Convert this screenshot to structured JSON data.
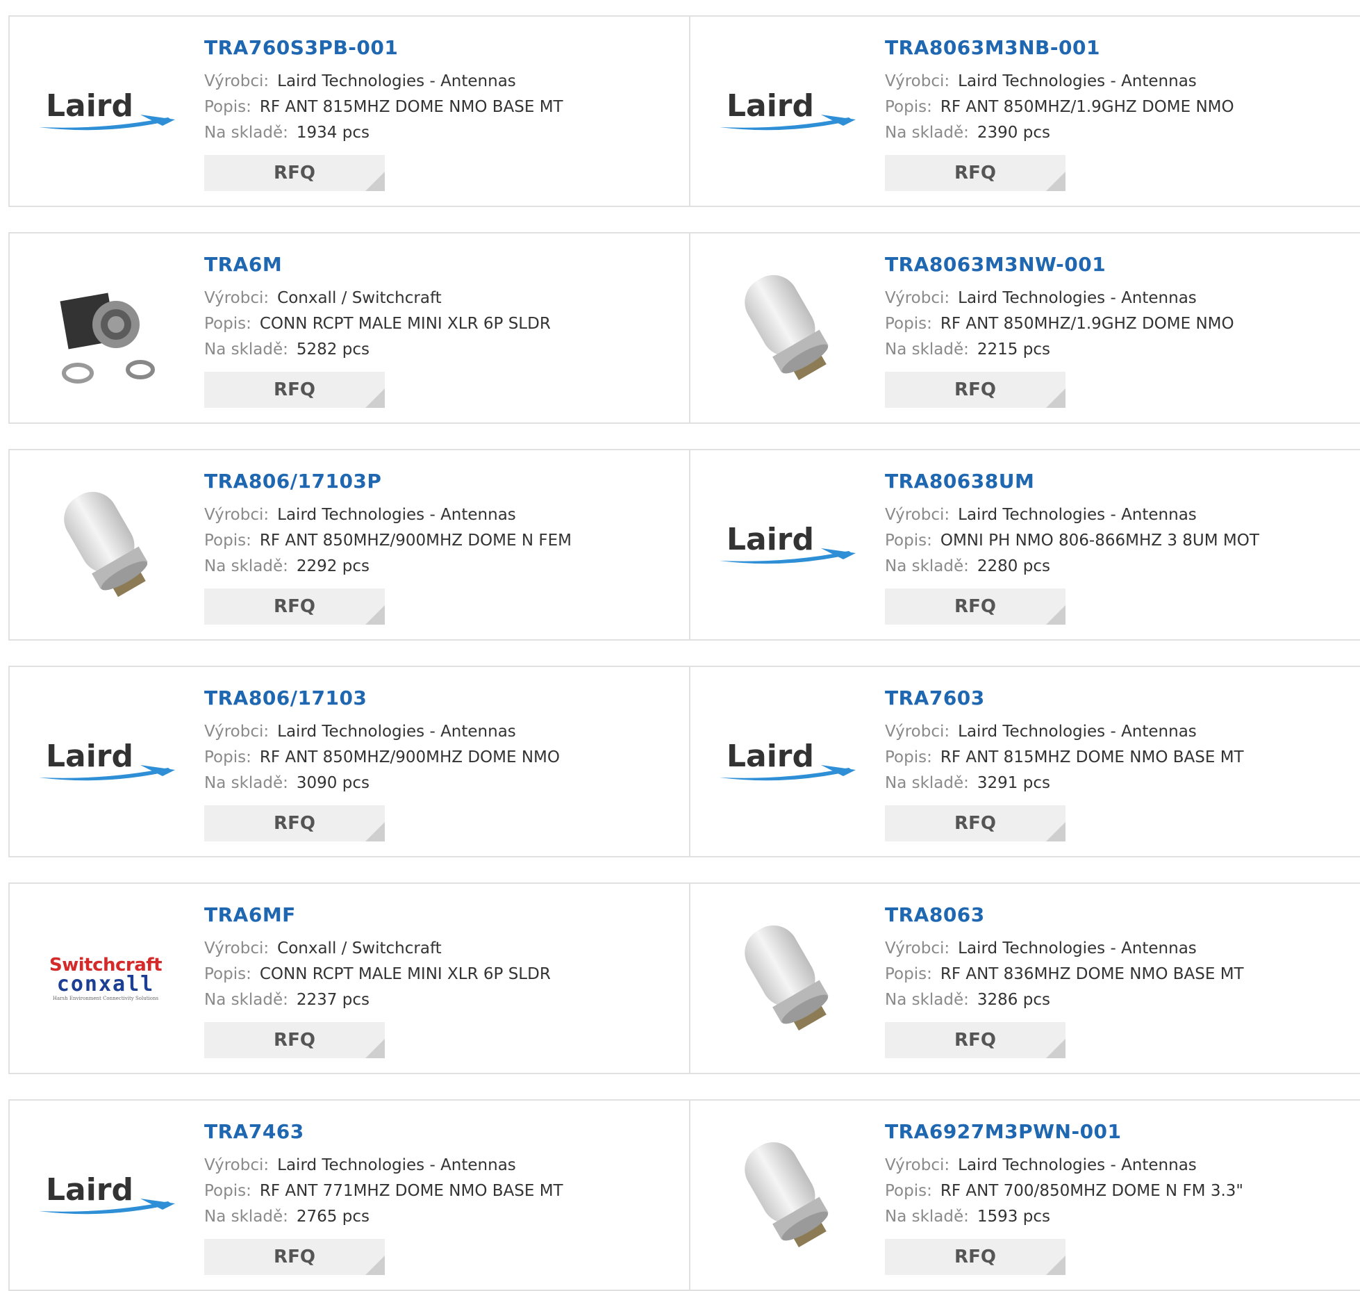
{
  "labels": {
    "manufacturer": "Výrobci:",
    "description": "Popis:",
    "stock": "Na skladě:",
    "rfq": "RFQ"
  },
  "logo_text": {
    "laird": "Laird",
    "switchcraft": "Switchcraft",
    "conxall": "conxall",
    "conxall_tagline": "Harsh Environment Connectivity Solutions"
  },
  "products": [
    {
      "part": "TRA760S3PB-001",
      "manufacturer": "Laird Technologies - Antennas",
      "description": "RF ANT 815MHZ DOME NMO BASE MT",
      "stock": "1934 pcs",
      "image": "laird-logo"
    },
    {
      "part": "TRA8063M3NB-001",
      "manufacturer": "Laird Technologies - Antennas",
      "description": "RF ANT 850MHZ/1.9GHZ DOME NMO",
      "stock": "2390 pcs",
      "image": "laird-logo"
    },
    {
      "part": "TRA6M",
      "manufacturer": "Conxall / Switchcraft",
      "description": "CONN RCPT MALE MINI XLR 6P SLDR",
      "stock": "5282 pcs",
      "image": "xlr-connector-photo"
    },
    {
      "part": "TRA8063M3NW-001",
      "manufacturer": "Laird Technologies - Antennas",
      "description": "RF ANT 850MHZ/1.9GHZ DOME NMO",
      "stock": "2215 pcs",
      "image": "antenna-photo"
    },
    {
      "part": "TRA806/17103P",
      "manufacturer": "Laird Technologies - Antennas",
      "description": "RF ANT 850MHZ/900MHZ DOME N FEM",
      "stock": "2292 pcs",
      "image": "antenna-photo"
    },
    {
      "part": "TRA80638UM",
      "manufacturer": "Laird Technologies - Antennas",
      "description": "OMNI PH NMO 806-866MHZ 3 8UM MOT",
      "stock": "2280 pcs",
      "image": "laird-logo"
    },
    {
      "part": "TRA806/17103",
      "manufacturer": "Laird Technologies - Antennas",
      "description": "RF ANT 850MHZ/900MHZ DOME NMO",
      "stock": "3090 pcs",
      "image": "laird-logo"
    },
    {
      "part": "TRA7603",
      "manufacturer": "Laird Technologies - Antennas",
      "description": "RF ANT 815MHZ DOME NMO BASE MT",
      "stock": "3291 pcs",
      "image": "laird-logo"
    },
    {
      "part": "TRA6MF",
      "manufacturer": "Conxall / Switchcraft",
      "description": "CONN RCPT MALE MINI XLR 6P SLDR",
      "stock": "2237 pcs",
      "image": "switchcraft-conxall-logo"
    },
    {
      "part": "TRA8063",
      "manufacturer": "Laird Technologies - Antennas",
      "description": "RF ANT 836MHZ DOME NMO BASE MT",
      "stock": "3286 pcs",
      "image": "antenna-photo"
    },
    {
      "part": "TRA7463",
      "manufacturer": "Laird Technologies - Antennas",
      "description": "RF ANT 771MHZ DOME NMO BASE MT",
      "stock": "2765 pcs",
      "image": "laird-logo"
    },
    {
      "part": "TRA6927M3PWN-001",
      "manufacturer": "Laird Technologies - Antennas",
      "description": "RF ANT 700/850MHZ DOME N FM 3.3\"",
      "stock": "1593 pcs",
      "image": "antenna-photo"
    }
  ],
  "colors": {
    "part_link": "#1f67b1",
    "label": "#8a8a8a",
    "border": "#e0e0e0",
    "rfq_bg": "#efefef"
  }
}
